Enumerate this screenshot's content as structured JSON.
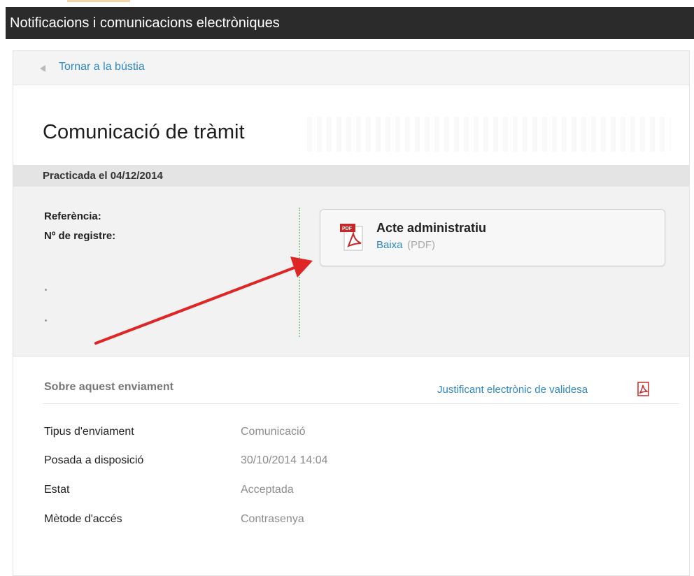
{
  "header": {
    "title": "Notificacions i comunicacions electròniques"
  },
  "back_link": {
    "label": "Tornar a la bústia"
  },
  "page": {
    "title": "Comunicació de tràmit"
  },
  "practicada": {
    "label": "Practicada el 04/12/2014"
  },
  "details": {
    "referencia_label": "Referència:",
    "registre_label": "Nº de registre:"
  },
  "document": {
    "title": "Acte administratiu",
    "download_label": "Baixa",
    "format": "(PDF)",
    "icon": "pdf-file-icon"
  },
  "sobre": {
    "heading": "Sobre aquest enviament",
    "justificant_label": "Justificant electrònic de validesa",
    "justificant_icon": "pdf-icon"
  },
  "info_rows": [
    {
      "label": "Tipus d'enviament",
      "value": "Comunicació"
    },
    {
      "label": "Posada a disposició",
      "value": "30/10/2014 14:04"
    },
    {
      "label": "Estat",
      "value": "Acceptada"
    },
    {
      "label": "Mètode d'accés",
      "value": "Contrasenya"
    }
  ],
  "colors": {
    "header_bg": "#2b2b2b",
    "link": "#2d87c8",
    "arrow": "#e02525",
    "pdf_red": "#c62828"
  }
}
